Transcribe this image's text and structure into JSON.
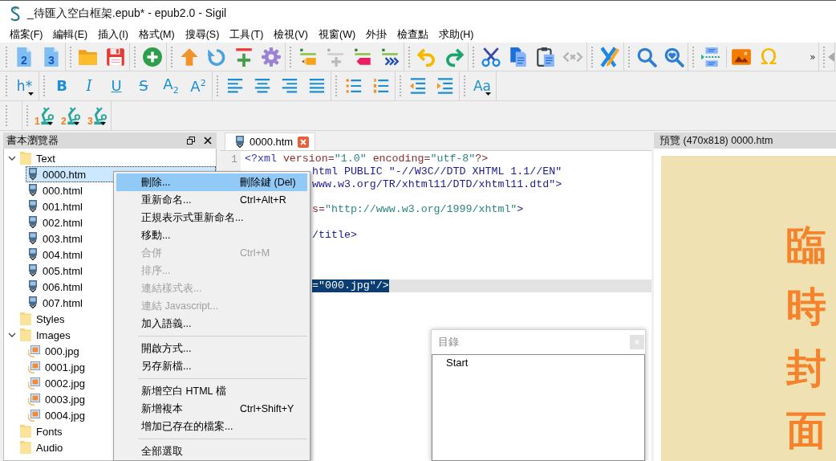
{
  "window": {
    "title": "_待匯入空白框架.epub* - epub2.0 - Sigil"
  },
  "menu_bar": [
    "檔案(F)",
    "編輯(E)",
    "插入(I)",
    "格式(M)",
    "搜尋(S)",
    "工具(T)",
    "檢視(V)",
    "視窗(W)",
    "外掛",
    "檢查點",
    "求助(H)"
  ],
  "toolbars": [
    [
      {
        "buttons": [
          {
            "kind": "new-book",
            "text": "2",
            "disabled": false
          },
          {
            "kind": "new-book",
            "text": "3",
            "disabled": false
          }
        ]
      },
      {
        "buttons": [
          {
            "kind": "open",
            "disabled": false
          },
          {
            "kind": "save",
            "disabled": false
          }
        ]
      },
      {
        "buttons": [
          {
            "kind": "add",
            "disabled": false
          }
        ]
      },
      {
        "buttons": [
          {
            "kind": "up",
            "disabled": false
          },
          {
            "kind": "refresh",
            "disabled": false
          },
          {
            "kind": "split",
            "disabled": false
          },
          {
            "kind": "gear",
            "disabled": false
          }
        ]
      },
      {
        "buttons": [
          {
            "kind": "mark-pencil",
            "disabled": false
          },
          {
            "kind": "mark-plus",
            "disabled": true
          },
          {
            "kind": "mark-tag",
            "disabled": false
          },
          {
            "kind": "mark-chevrons",
            "disabled": false
          }
        ]
      },
      {
        "buttons": [
          {
            "kind": "undo",
            "disabled": false
          },
          {
            "kind": "redo",
            "disabled": false
          }
        ]
      },
      {
        "buttons": [
          {
            "kind": "cut",
            "disabled": false
          },
          {
            "kind": "copy",
            "disabled": false
          },
          {
            "kind": "paste",
            "disabled": false
          },
          {
            "kind": "tags",
            "disabled": true
          }
        ]
      },
      {
        "buttons": [
          {
            "kind": "validate",
            "disabled": false
          }
        ]
      },
      {
        "buttons": [
          {
            "kind": "search",
            "disabled": false
          },
          {
            "kind": "search-saved",
            "disabled": false
          }
        ]
      },
      {
        "buttons": [
          {
            "kind": "toc",
            "disabled": false
          },
          {
            "kind": "separator"
          },
          {
            "kind": "image",
            "disabled": false
          },
          {
            "kind": "character",
            "text": "Ω",
            "disabled": false
          },
          {
            "kind": "overflow",
            "text": "»",
            "disabled": false
          }
        ]
      },
      {
        "buttons": [
          {
            "kind": "scroll-left",
            "disabled": true
          }
        ]
      }
    ],
    [
      {
        "buttons": [
          {
            "kind": "heading",
            "text": "h*"
          }
        ]
      },
      {
        "buttons": [
          {
            "kind": "bold",
            "text": "B"
          },
          {
            "kind": "italic",
            "text": "I"
          },
          {
            "kind": "underline",
            "text": "U"
          },
          {
            "kind": "strike",
            "text": "S"
          },
          {
            "kind": "subscript",
            "text": "A$_{2}$"
          },
          {
            "kind": "superscript",
            "text": "A$^{2}$"
          }
        ]
      },
      {
        "buttons": [
          {
            "kind": "align-left"
          },
          {
            "kind": "align-center"
          },
          {
            "kind": "align-right"
          },
          {
            "kind": "justify"
          }
        ]
      },
      {
        "buttons": [
          {
            "kind": "bullets"
          },
          {
            "kind": "numbering"
          }
        ]
      },
      {
        "buttons": [
          {
            "kind": "outdent"
          },
          {
            "kind": "indent"
          }
        ]
      },
      {
        "buttons": [
          {
            "kind": "case",
            "text": "Aa"
          }
        ]
      }
    ],
    [
      {
        "kind": "empty"
      },
      {
        "kind": "buttons",
        "buttons": [
          {
            "kind": "plugin",
            "text": "1"
          },
          {
            "kind": "plugin",
            "text": "2"
          },
          {
            "kind": "plugin",
            "text": "3"
          }
        ]
      }
    ]
  ],
  "book_browser": {
    "title": "書本瀏覽器",
    "tree": [
      {
        "label": "Text",
        "kind": "folder",
        "expanded": true,
        "selected": false,
        "children": [
          {
            "label": "0000.htm",
            "kind": "html",
            "selected": true
          },
          {
            "label": "000.html",
            "kind": "html",
            "selected": false
          },
          {
            "label": "001.html",
            "kind": "html",
            "selected": false
          },
          {
            "label": "002.html",
            "kind": "html",
            "selected": false
          },
          {
            "label": "003.html",
            "kind": "html",
            "selected": false
          },
          {
            "label": "004.html",
            "kind": "html",
            "selected": false
          },
          {
            "label": "005.html",
            "kind": "html",
            "selected": false
          },
          {
            "label": "006.html",
            "kind": "html",
            "selected": false
          },
          {
            "label": "007.html",
            "kind": "html",
            "selected": false
          }
        ]
      },
      {
        "label": "Styles",
        "kind": "folder",
        "selected": false
      },
      {
        "label": "Images",
        "kind": "folder",
        "expanded": true,
        "selected": false,
        "children": [
          {
            "label": "000.jpg",
            "kind": "image",
            "selected": false
          },
          {
            "label": "0001.jpg",
            "kind": "image",
            "selected": false
          },
          {
            "label": "0002.jpg",
            "kind": "image",
            "selected": false
          },
          {
            "label": "0003.jpg",
            "kind": "image",
            "selected": false
          },
          {
            "label": "0004.jpg",
            "kind": "image",
            "selected": false
          }
        ]
      },
      {
        "label": "Fonts",
        "kind": "folder",
        "selected": false
      },
      {
        "label": "Audio",
        "kind": "folder",
        "selected": false
      }
    ]
  },
  "context_menu": {
    "groups": [
      [
        {
          "label": "刪除...",
          "shortcut": "刪除鍵 (Del)",
          "disabled": false,
          "selected": true
        },
        {
          "label": "重新命名...",
          "shortcut": "Ctrl+Alt+R",
          "disabled": false,
          "selected": false
        },
        {
          "label": "正規表示式重新命名...",
          "disabled": false,
          "selected": false
        },
        {
          "label": "移動...",
          "disabled": false,
          "selected": false
        },
        {
          "label": "合併",
          "shortcut": "Ctrl+M",
          "disabled": true,
          "selected": false
        },
        {
          "label": "排序...",
          "disabled": true,
          "selected": false
        },
        {
          "label": "連結樣式表...",
          "disabled": true,
          "selected": false
        },
        {
          "label": "連結 Javascript...",
          "disabled": true,
          "selected": false
        },
        {
          "label": "加入語義...",
          "disabled": false,
          "selected": false
        }
      ],
      [
        {
          "label": "開啟方式...",
          "disabled": false,
          "selected": false
        },
        {
          "label": "另存新檔...",
          "disabled": false,
          "selected": false
        }
      ],
      [
        {
          "label": "新增空白 HTML 檔",
          "disabled": false,
          "selected": false
        },
        {
          "label": "新增複本",
          "shortcut": "Ctrl+Shift+Y",
          "disabled": false,
          "selected": false
        },
        {
          "label": "增加已存在的檔案...",
          "disabled": false,
          "selected": false
        }
      ],
      [
        {
          "label": "全部選取",
          "disabled": false,
          "selected": false
        }
      ]
    ]
  },
  "editor": {
    "tab": {
      "label": "0000.htm",
      "selected": true
    },
    "lines": [
      {
        "number": "1",
        "code": "<?xml version=\"1.0\" encoding=\"utf-8\"?>",
        "current": false,
        "selected": false
      },
      {
        "code": "html PUBLIC \"-//W3C//DTD XHTML 1.1//EN\"",
        "current": false,
        "selected": false
      },
      {
        "code": "www.w3.org/TR/xhtml11/DTD/xhtml11.dtd\">",
        "current": false,
        "selected": false
      },
      {
        "current": false
      },
      {
        "code": "s=\"http://www.w3.org/1999/xhtml\">",
        "current": false,
        "selected": false
      },
      {
        "current": false
      },
      {
        "code": "/title>",
        "current": false,
        "selected": false
      },
      {
        "current": false
      },
      {
        "current": false
      },
      {
        "current": false
      },
      {
        "code": "=\"000.jpg\"/>",
        "current": true,
        "selected": true
      }
    ]
  },
  "toc": {
    "title": "目錄",
    "items": [
      {
        "label": "Start",
        "selected": false
      }
    ]
  },
  "preview": {
    "title": "預覽 (470x818) 0000.htm",
    "page_text": "臨時封面"
  }
}
